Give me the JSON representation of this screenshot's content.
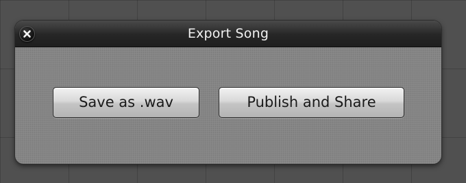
{
  "dialog": {
    "title": "Export Song",
    "close_icon": "close-icon",
    "buttons": {
      "save_wav_label": "Save as .wav",
      "publish_label": "Publish and Share"
    }
  },
  "colors": {
    "background": "#505050",
    "dialog_body": "#8a8a8a",
    "titlebar": "#262626",
    "title_text": "#f2f2f2",
    "button_face": "#d9d9d9"
  }
}
